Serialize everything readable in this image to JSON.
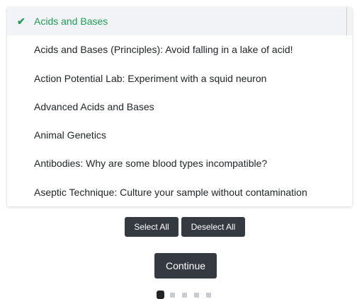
{
  "list": {
    "items": [
      {
        "label": "Acids and Bases",
        "selected": true
      },
      {
        "label": "Acids and Bases (Principles): Avoid falling in a lake of acid!",
        "selected": false
      },
      {
        "label": "Action Potential Lab: Experiment with a squid neuron",
        "selected": false
      },
      {
        "label": "Advanced Acids and Bases",
        "selected": false
      },
      {
        "label": "Animal Genetics",
        "selected": false
      },
      {
        "label": "Antibodies: Why are some blood types incompatible?",
        "selected": false
      },
      {
        "label": "Aseptic Technique: Culture your sample without contamination",
        "selected": false
      }
    ],
    "check_icon": "checkmark-icon"
  },
  "buttons": {
    "select_all": "Select All",
    "deselect_all": "Deselect All",
    "continue": "Continue"
  },
  "pager": {
    "total": 5,
    "current": 1
  },
  "colors": {
    "selected_text": "#1f9d55",
    "button_bg": "#343a40"
  }
}
